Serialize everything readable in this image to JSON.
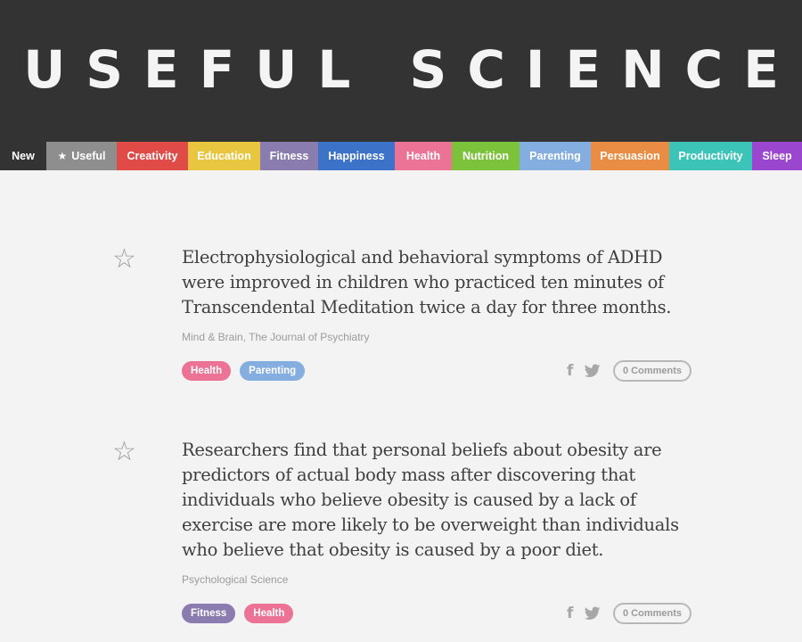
{
  "site": {
    "title": "USEFUL SCIENCE"
  },
  "nav": {
    "items": [
      {
        "label": "New",
        "color": "#333333"
      },
      {
        "label": "Useful",
        "color": "#8e8e8e",
        "icon": "star-icon"
      },
      {
        "label": "Creativity",
        "color": "#e04a47"
      },
      {
        "label": "Education",
        "color": "#e8c640"
      },
      {
        "label": "Fitness",
        "color": "#8b7cb0"
      },
      {
        "label": "Happiness",
        "color": "#3c73c8"
      },
      {
        "label": "Health",
        "color": "#ec7395"
      },
      {
        "label": "Nutrition",
        "color": "#7dc23b"
      },
      {
        "label": "Parenting",
        "color": "#84aee0"
      },
      {
        "label": "Persuasion",
        "color": "#e98c44"
      },
      {
        "label": "Productivity",
        "color": "#3cc4b8"
      },
      {
        "label": "Sleep",
        "color": "#9a46cf"
      }
    ]
  },
  "articles": [
    {
      "title_lines": [
        "Electrophysiological and behavioral symptoms of ADHD",
        "were improved in children who practiced ten minutes of",
        "Transcendental Meditation twice a day for three months."
      ],
      "source": "Mind & Brain, The Journal of Psychiatry",
      "tags": [
        {
          "label": "Health",
          "color": "#ec7395"
        },
        {
          "label": "Parenting",
          "color": "#84aee0"
        }
      ],
      "comments_label": "0 Comments"
    },
    {
      "title_lines": [
        "Researchers find that personal beliefs about obesity are",
        "predictors of actual body mass after discovering that",
        "individuals who believe obesity is caused by a lack of",
        "exercise are more likely to be overweight than individuals",
        "who believe that obesity is caused by a poor diet."
      ],
      "source": "Psychological Science",
      "tags": [
        {
          "label": "Fitness",
          "color": "#8b7cb0"
        },
        {
          "label": "Health",
          "color": "#ec7395"
        }
      ],
      "comments_label": "0 Comments"
    }
  ],
  "icons": {
    "favorite": "star-outline-icon",
    "facebook": "facebook-icon",
    "twitter": "twitter-icon"
  },
  "colors": {
    "header_bg": "#333333",
    "page_bg": "#f3f3f3",
    "text": "#3f3f3f",
    "muted": "#9b9b9b"
  }
}
